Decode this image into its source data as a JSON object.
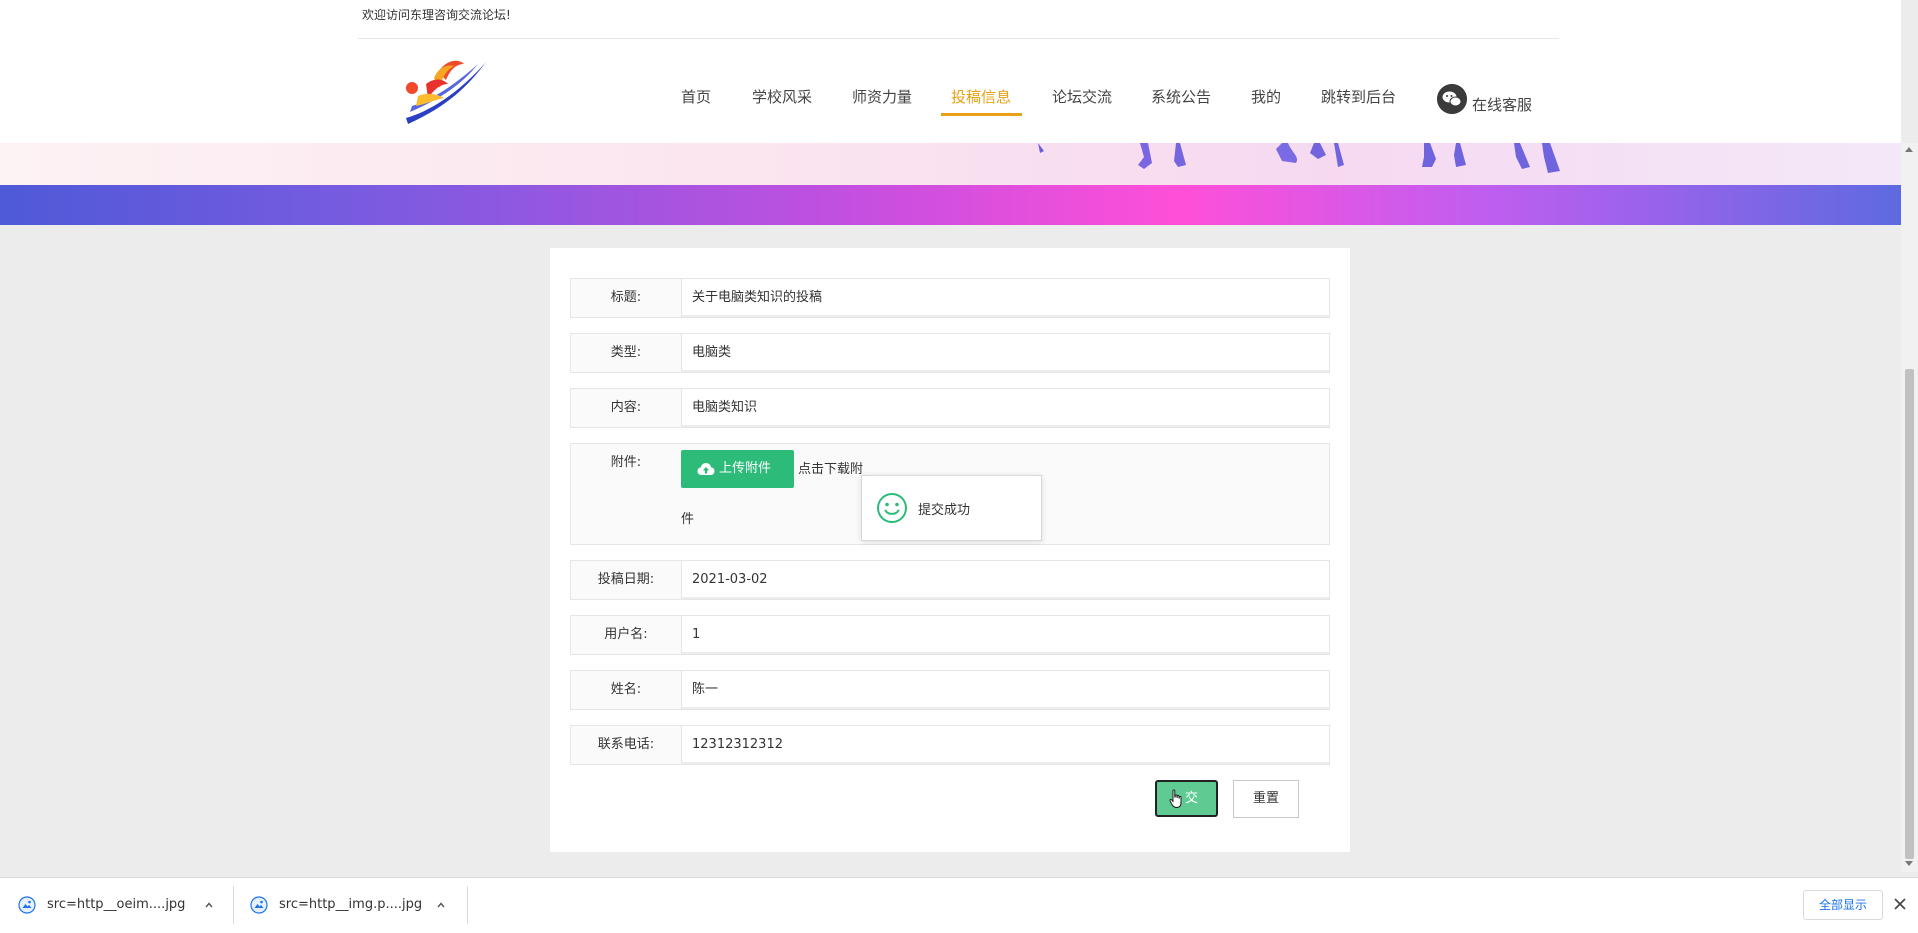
{
  "header": {
    "welcome": "欢迎访问东理咨询交流论坛!",
    "nav": [
      {
        "label": "首页"
      },
      {
        "label": "学校风采"
      },
      {
        "label": "师资力量"
      },
      {
        "label": "投稿信息",
        "active": true
      },
      {
        "label": "论坛交流"
      },
      {
        "label": "系统公告"
      },
      {
        "label": "我的"
      },
      {
        "label": "跳转到后台"
      }
    ],
    "service": "在线客服",
    "accent_color": "#e8a115"
  },
  "form": {
    "fields": [
      {
        "label": "标题:",
        "value": "关于电脑类知识的投稿"
      },
      {
        "label": "类型:",
        "value": "电脑类"
      },
      {
        "label": "内容:",
        "value": "电脑类知识"
      },
      {
        "label": "投稿日期:",
        "value": "2021-03-02"
      },
      {
        "label": "用户名:",
        "value": "1"
      },
      {
        "label": "姓名:",
        "value": "陈一"
      },
      {
        "label": "联系电话:",
        "value": "12312312312"
      }
    ],
    "attachment": {
      "label": "附件:",
      "upload_button": "上传附件",
      "download_text_1": "点击下载附",
      "download_text_2": "件"
    },
    "submit_label": "交",
    "reset_label": "重置",
    "primary_color": "#2dbb7a"
  },
  "toast": {
    "message": "提交成功",
    "icon": "smile-icon"
  },
  "download_bar": {
    "items": [
      {
        "name": "src=http__oeim....jpg"
      },
      {
        "name": "src=http__img.p....jpg"
      }
    ],
    "show_all": "全部显示"
  }
}
